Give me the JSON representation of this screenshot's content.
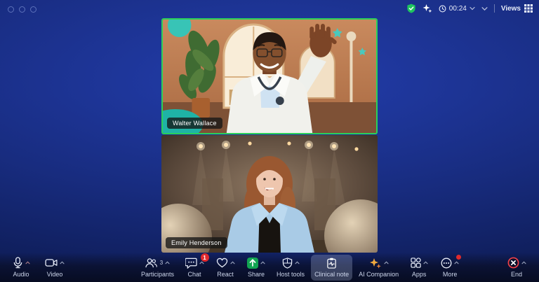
{
  "colors": {
    "background_blue": "#1d3494",
    "toolbar_bg": "#070c22",
    "active_speaker_green": "#2bd05a",
    "share_green": "#12a452",
    "security_green": "#1fc45f",
    "end_red": "#ef4048",
    "badge_red": "#e02a2d",
    "selected_button_bg": "#aab6d7"
  },
  "top_bar": {
    "timer": "00:24",
    "views_label": "Views",
    "icons": [
      "security-shield-check-icon",
      "ai-companion-sparkle-icon",
      "clock-icon",
      "chevron-down-icon",
      "grid-views-icon"
    ]
  },
  "tiles": [
    {
      "name": "Walter Wallace",
      "active_speaker": true
    },
    {
      "name": "Emily Henderson",
      "active_speaker": false
    }
  ],
  "toolbar": {
    "buttons": [
      {
        "label": "Audio",
        "icon": "microphone-icon"
      },
      {
        "label": "Video",
        "icon": "video-camera-icon"
      },
      {
        "label": "Participants",
        "icon": "participants-icon",
        "count": "3"
      },
      {
        "label": "Chat",
        "icon": "chat-bubble-icon",
        "badge": "1"
      },
      {
        "label": "React",
        "icon": "heart-icon"
      },
      {
        "label": "Share",
        "icon": "share-screen-icon"
      },
      {
        "label": "Host tools",
        "icon": "shield-icon"
      },
      {
        "label": "Clinical note",
        "icon": "clinical-note-icon",
        "selected": true
      },
      {
        "label": "AI Companion",
        "icon": "ai-sparkle-icon"
      },
      {
        "label": "Apps",
        "icon": "apps-icon"
      },
      {
        "label": "More",
        "icon": "ellipsis-icon",
        "has_red_dot": true
      },
      {
        "label": "End",
        "icon": "end-call-icon"
      }
    ]
  }
}
